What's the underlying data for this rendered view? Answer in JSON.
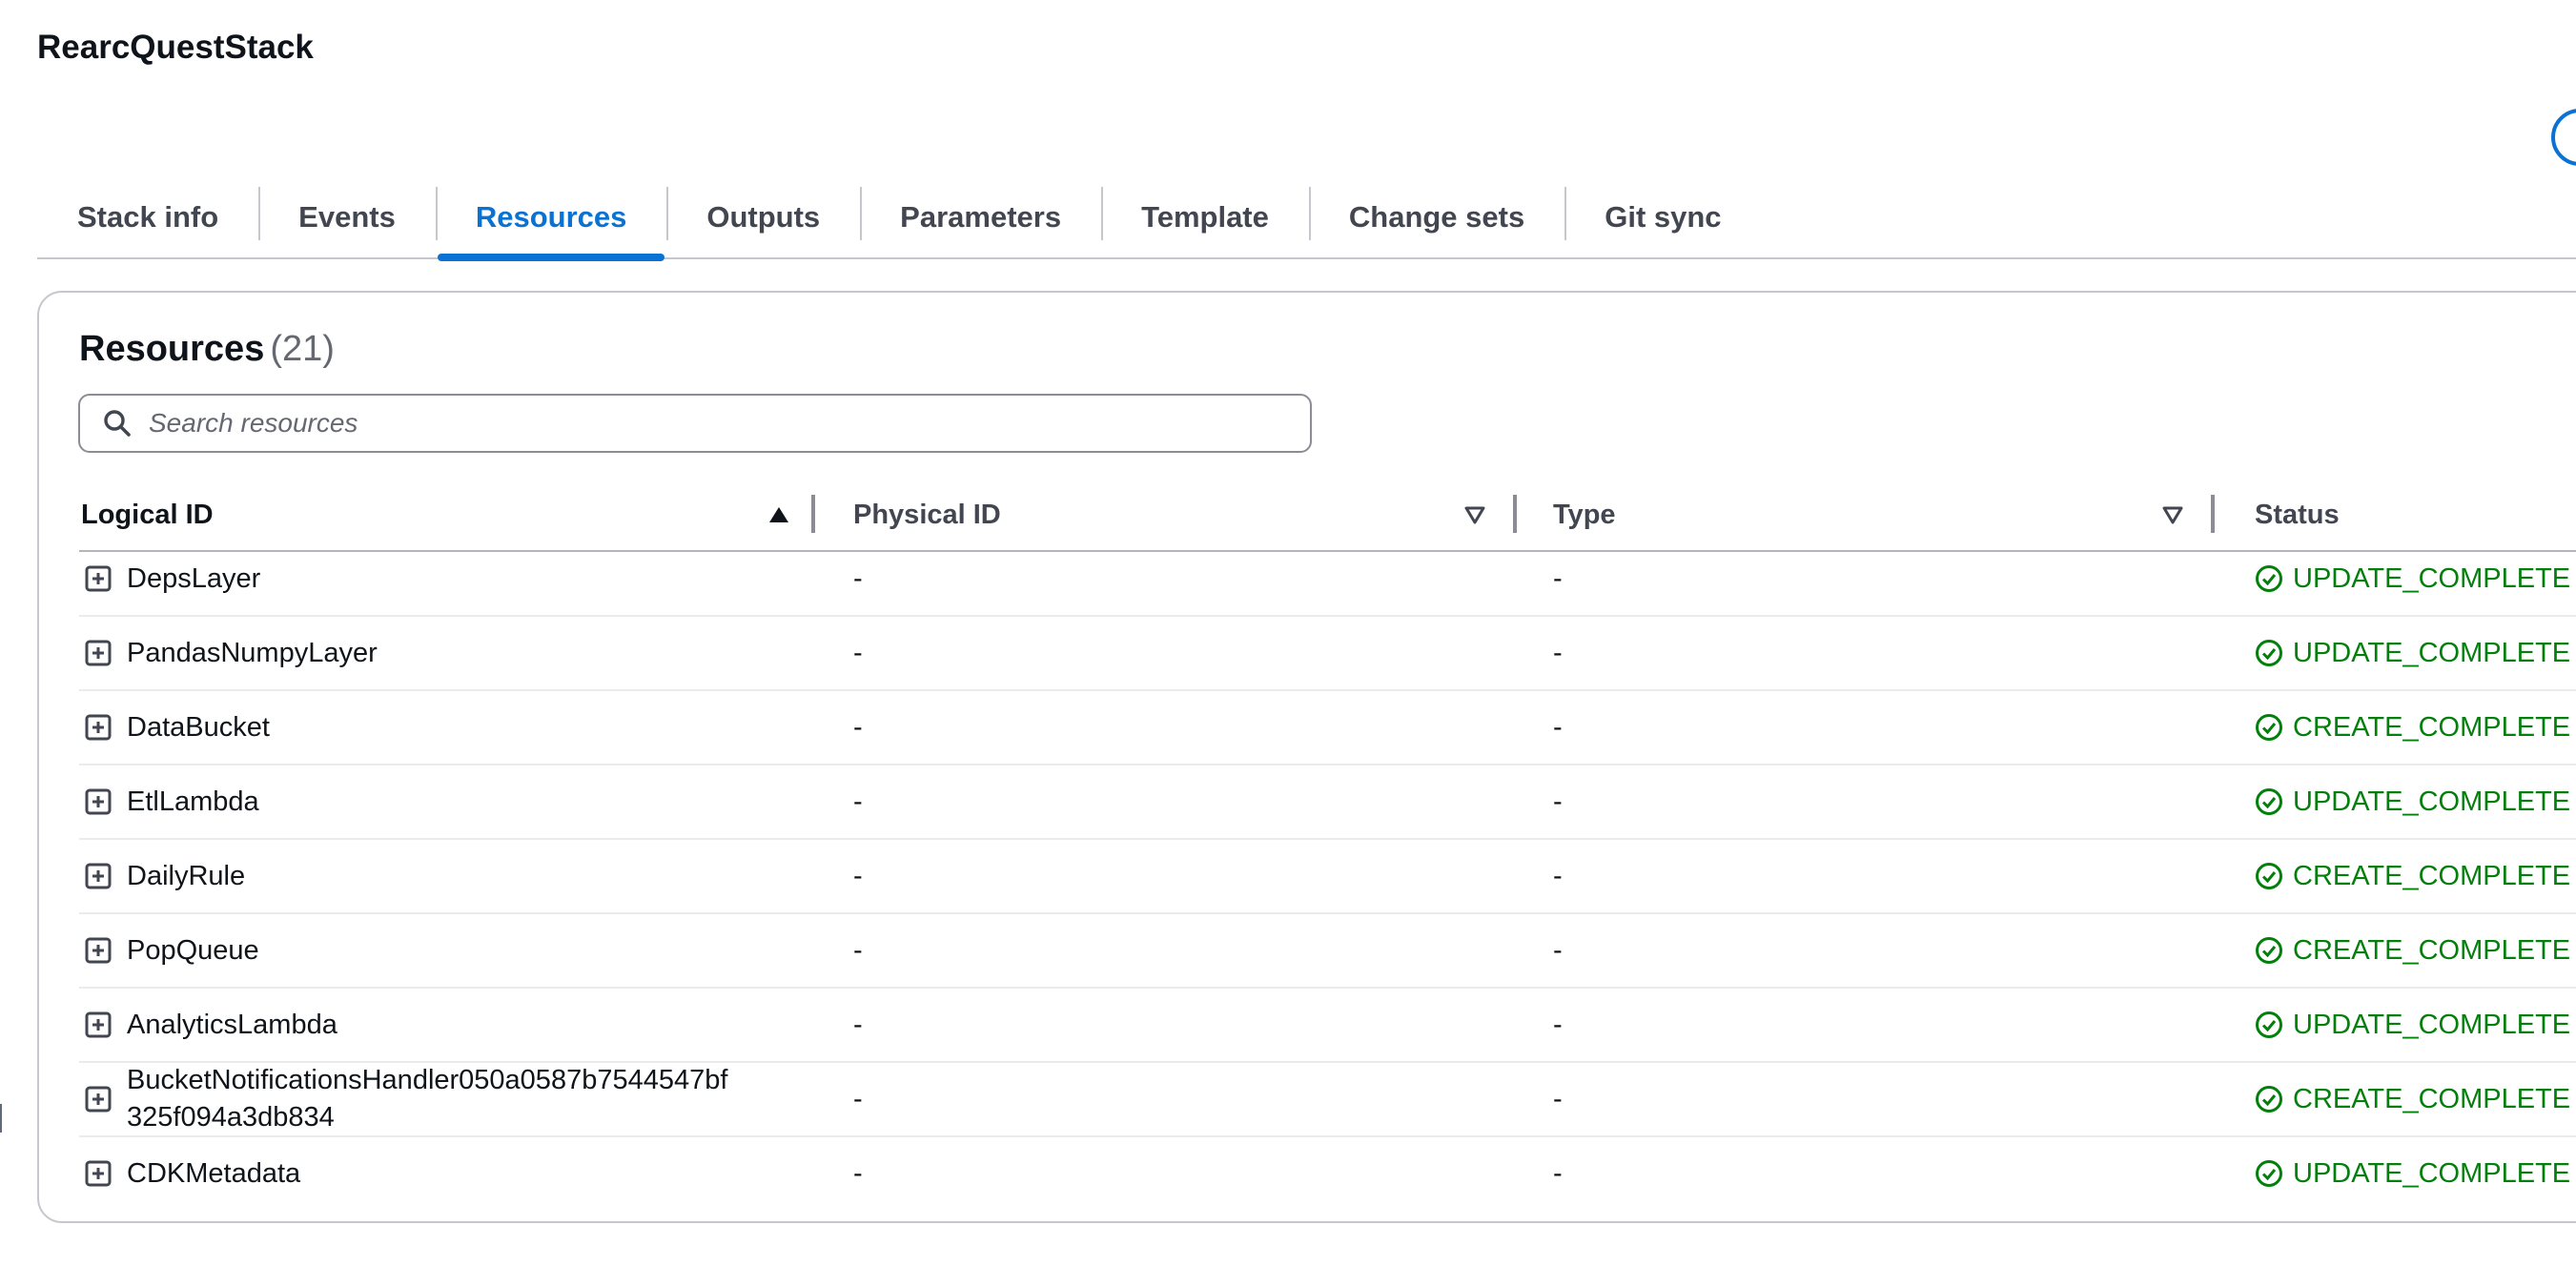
{
  "page": {
    "stack_name": "RearcQuestStack"
  },
  "tabs": [
    {
      "label": "Stack info",
      "active": false
    },
    {
      "label": "Events",
      "active": false
    },
    {
      "label": "Resources",
      "active": true
    },
    {
      "label": "Outputs",
      "active": false
    },
    {
      "label": "Parameters",
      "active": false
    },
    {
      "label": "Template",
      "active": false
    },
    {
      "label": "Change sets",
      "active": false
    },
    {
      "label": "Git sync",
      "active": false
    }
  ],
  "resources": {
    "title": "Resources",
    "count": "(21)",
    "search_placeholder": "Search resources",
    "columns": {
      "logical_id": "Logical ID",
      "physical_id": "Physical ID",
      "type": "Type",
      "status": "Status"
    },
    "sort": {
      "column": "logical_id",
      "direction": "ascending"
    },
    "rows": [
      {
        "logical_id": "DepsLayer",
        "physical_id": "-",
        "type": "-",
        "status": "UPDATE_COMPLETE"
      },
      {
        "logical_id": "PandasNumpyLayer",
        "physical_id": "-",
        "type": "-",
        "status": "UPDATE_COMPLETE"
      },
      {
        "logical_id": "DataBucket",
        "physical_id": "-",
        "type": "-",
        "status": "CREATE_COMPLETE"
      },
      {
        "logical_id": "EtlLambda",
        "physical_id": "-",
        "type": "-",
        "status": "UPDATE_COMPLETE"
      },
      {
        "logical_id": "DailyRule",
        "physical_id": "-",
        "type": "-",
        "status": "CREATE_COMPLETE"
      },
      {
        "logical_id": "PopQueue",
        "physical_id": "-",
        "type": "-",
        "status": "CREATE_COMPLETE"
      },
      {
        "logical_id": "AnalyticsLambda",
        "physical_id": "-",
        "type": "-",
        "status": "UPDATE_COMPLETE"
      },
      {
        "logical_id": "BucketNotificationsHandler050a0587b7544547bf325f094a3db834",
        "logical_id_line1": "BucketNotificationsHandler050a0587b7544547bf",
        "logical_id_line2": "325f094a3db834",
        "physical_id": "-",
        "type": "-",
        "status": "CREATE_COMPLETE"
      },
      {
        "logical_id": "CDKMetadata",
        "physical_id": "-",
        "type": "-",
        "status": "UPDATE_COMPLETE"
      }
    ]
  },
  "colors": {
    "accent": "#0972d3",
    "success": "#037f0c",
    "text": "#0f141a",
    "muted": "#656871"
  },
  "icons": [
    "search-icon",
    "sort-ascending-icon",
    "sort-descending-icon",
    "expand-plus-icon",
    "status-success-icon"
  ]
}
